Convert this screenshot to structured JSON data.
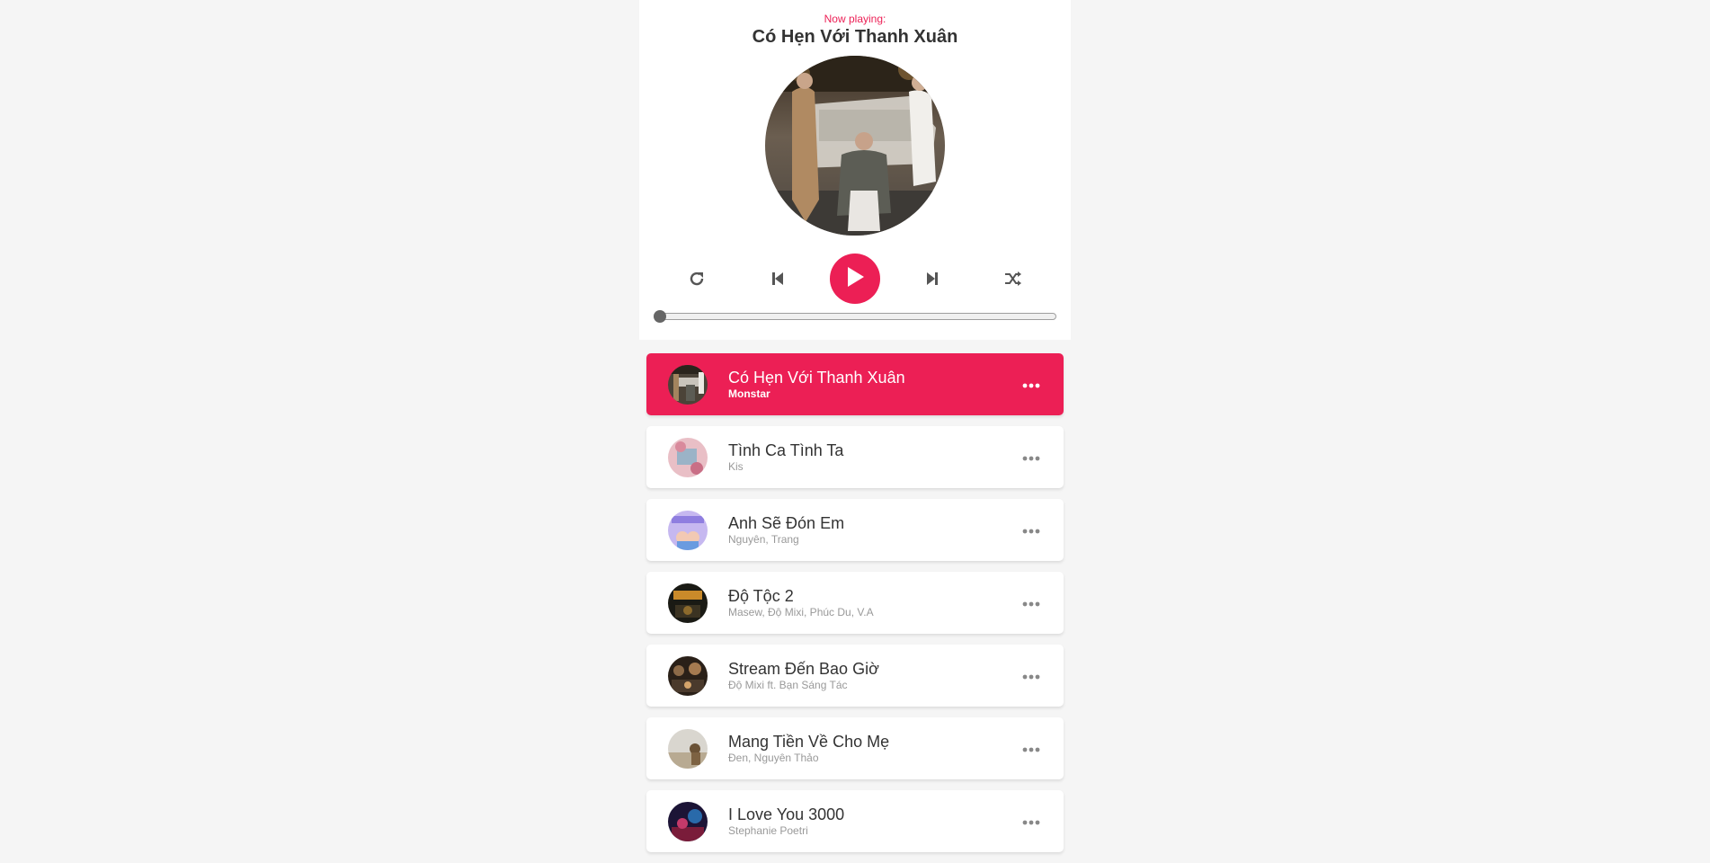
{
  "header": {
    "now_playing_label": "Now playing:",
    "current_title": "Có Hẹn Với Thanh Xuân"
  },
  "controls": {
    "repeat_icon": "repeat-icon",
    "prev_icon": "step-backward-icon",
    "play_icon": "play-icon",
    "next_icon": "step-forward-icon",
    "random_icon": "shuffle-icon"
  },
  "progress": {
    "value_percent": 0
  },
  "colors": {
    "accent": "#ec1f55",
    "text": "#333333",
    "subtext": "#999999",
    "background": "#f5f5f5"
  },
  "playlist": [
    {
      "name": "Có Hẹn Với Thanh Xuân",
      "artist": "Monstar",
      "active": true
    },
    {
      "name": "Tình Ca Tình Ta",
      "artist": "Kis",
      "active": false
    },
    {
      "name": "Anh Sẽ Đón Em",
      "artist": "Nguyên, Trang",
      "active": false
    },
    {
      "name": "Độ Tộc 2",
      "artist": "Masew, Độ Mixi, Phúc Du, V.A",
      "active": false
    },
    {
      "name": "Stream Đến Bao Giờ",
      "artist": "Độ Mixi ft. Bạn Sáng Tác",
      "active": false
    },
    {
      "name": "Mang Tiền Về Cho Mẹ",
      "artist": "Đen, Nguyên Thảo",
      "active": false
    },
    {
      "name": "I Love You 3000",
      "artist": "Stephanie Poetri",
      "active": false
    }
  ],
  "option_icon": "ellipsis-icon"
}
